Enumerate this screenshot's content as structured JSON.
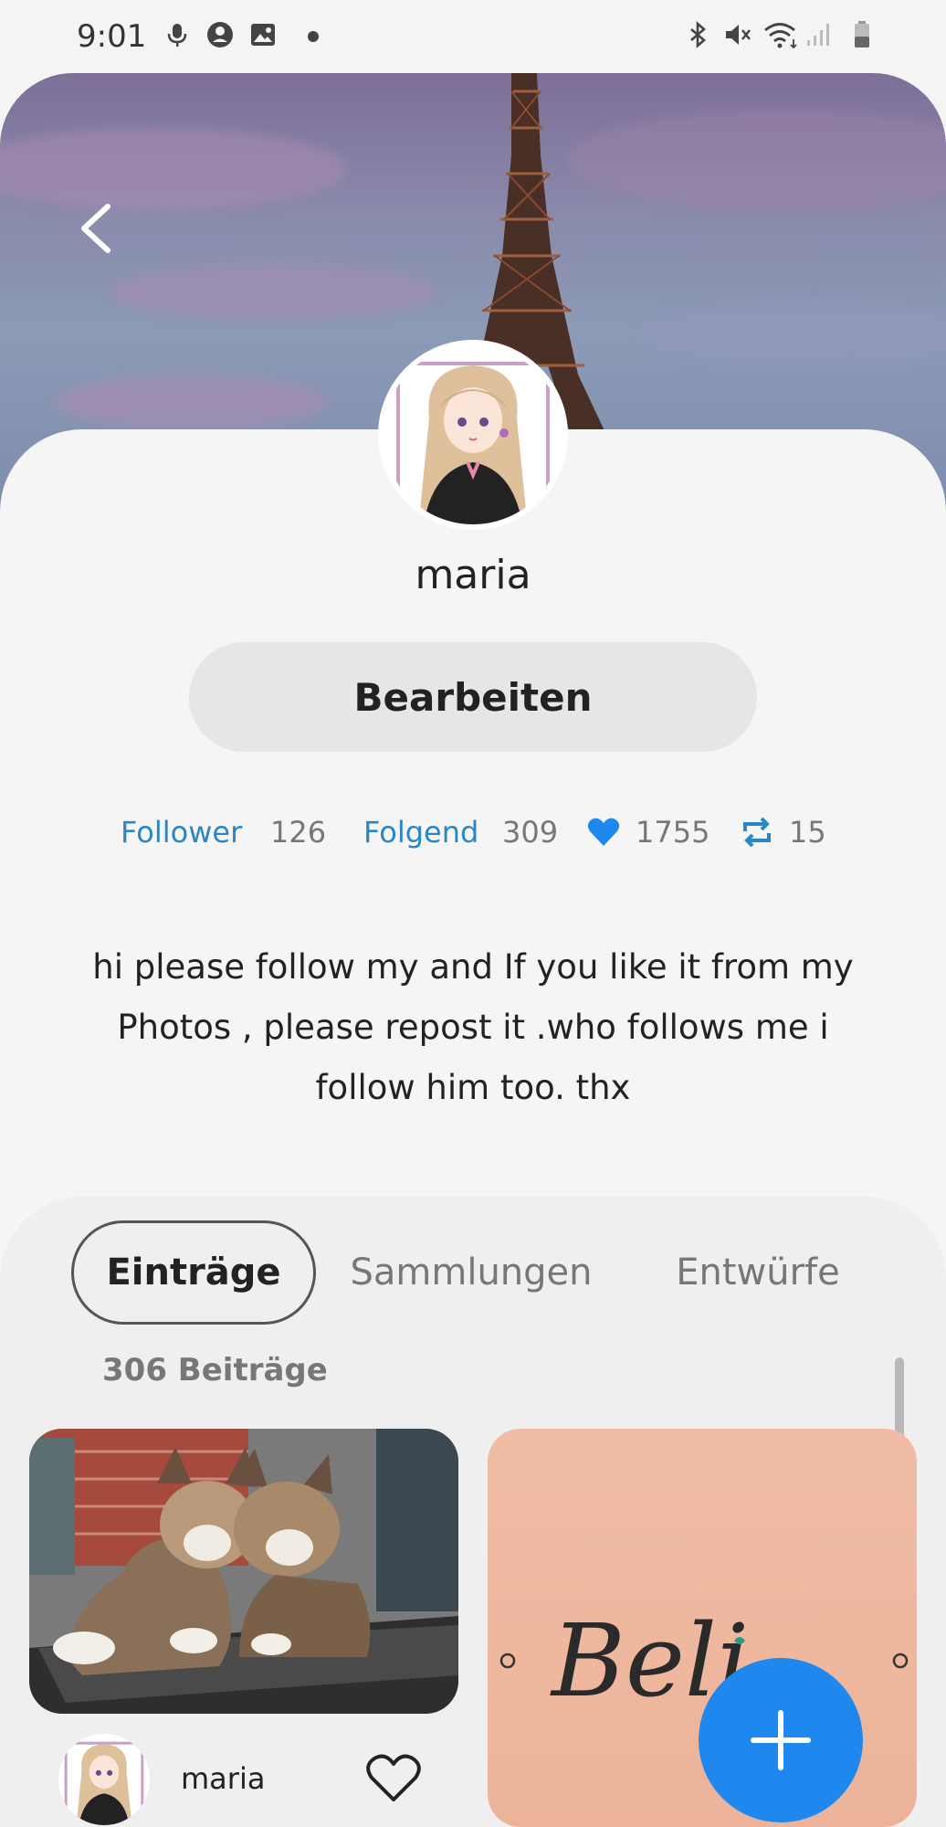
{
  "status_bar": {
    "time": "9:01",
    "icons": [
      "mic-icon",
      "face-icon",
      "image-icon",
      "notification-dot",
      "bluetooth-icon",
      "mute-icon",
      "wifi-icon",
      "signal-icon",
      "battery-icon"
    ]
  },
  "profile": {
    "username": "maria",
    "edit_label": "Bearbeiten",
    "bio": "hi please follow my and If you like it from my Photos , please repost it .who follows me i follow him too. thx"
  },
  "stats": {
    "follower_label": "Follower",
    "follower_count": "126",
    "following_label": "Folgend",
    "following_count": "309",
    "likes_count": "1755",
    "reposts_count": "15"
  },
  "tabs": [
    {
      "label": "Einträge",
      "active": true
    },
    {
      "label": "Sammlungen",
      "active": false
    },
    {
      "label": "Entwürfe",
      "active": false
    }
  ],
  "posts": {
    "count_label": "306 Beiträge",
    "items": [
      {
        "author": "maria",
        "image": "two-cats-photo"
      },
      {
        "image": "believe-text-photo",
        "visible_text": "Beli"
      }
    ]
  },
  "colors": {
    "accent_blue": "#2a86c6",
    "fab_blue": "#1e88ee",
    "heart_blue": "#1e88ee"
  }
}
